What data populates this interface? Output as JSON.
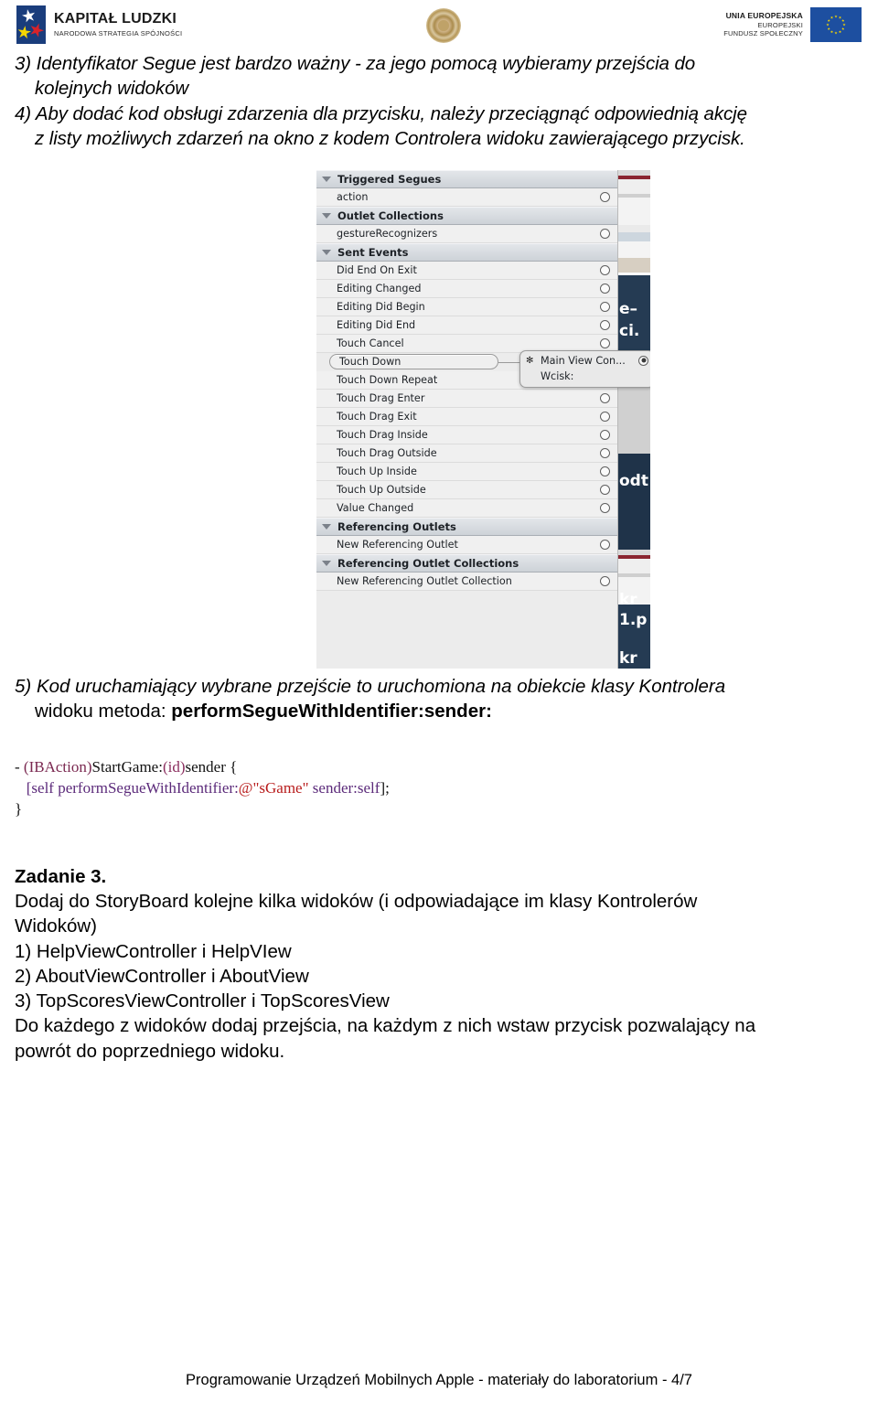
{
  "header": {
    "left_logo": {
      "title": "KAPITAŁ LUDZKI",
      "subtitle": "NARODOWA STRATEGIA SPÓJNOŚCI",
      "emblem": "kapital-ludzki-stars-emblem"
    },
    "center_logo": {
      "emblem": "university-gold-seal"
    },
    "right_logo": {
      "line1": "UNIA EUROPEJSKA",
      "line2": "EUROPEJSKI",
      "line3": "FUNDUSZ SPOŁECZNY",
      "emblem": "eu-flag-icon",
      "flag_color": "#1d4fa0",
      "star_color": "#f5d500"
    }
  },
  "body": {
    "item3": {
      "marker": "3)",
      "line1": "Identyfikator Segue jest bardzo ważny - za jego pomocą wybieramy przejścia do",
      "line2": "kolejnych widoków"
    },
    "item4": {
      "marker": "4)",
      "line1": "Aby dodać kod obsługi zdarzenia dla przycisku, należy przeciągnąć odpowiednią akcję",
      "line2": "z listy możliwych zdarzeń na okno z kodem Controlera widoku zawierającego przycisk."
    },
    "item5": {
      "marker": "5)",
      "line1": "Kod uruchamiający wybrane przejście to uruchomiona na obiekcie klasy Kontrolera",
      "line2_prefix": "widoku metoda: ",
      "line2_bold": "performSegueWithIdentifier:sender:"
    },
    "code": {
      "l1_dash": "- ",
      "l1_ibaction": "(IBAction)",
      "l1_name": "StartGame:",
      "l1_id": "(id)",
      "l1_sender": "sender {",
      "l2_open": "[self ",
      "l2_msg": "performSegueWithIdentifier:",
      "l2_str": "@\"sGame\"",
      "l2_sender": " sender:self",
      "l2_close": "];",
      "l3": "}"
    },
    "zadanie": {
      "title": "Zadanie 3.",
      "intro1": "Dodaj do StoryBoard kolejne kilka widoków (i odpowiadające im klasy Kontrolerów",
      "intro2": "Widoków)",
      "items": [
        "1) HelpViewController i HelpVIew",
        "2) AboutViewController i AboutView",
        "3) TopScoresViewController i TopScoresView"
      ],
      "outro1": "Do każdego z widoków dodaj przejścia, na każdym z nich wstaw przycisk pozwalający na",
      "outro2": "powrót do poprzedniego widoku."
    }
  },
  "screenshot": {
    "caption": "xcode-connections-inspector",
    "sections": [
      {
        "title": "Triggered Segues"
      },
      {
        "title": "Outlet Collections"
      },
      {
        "title": "Sent Events"
      },
      {
        "title": "Referencing Outlets"
      },
      {
        "title": "Referencing Outlet Collections"
      }
    ],
    "triggered_segues": [
      {
        "label": "action",
        "connected": false
      }
    ],
    "outlet_collections": [
      {
        "label": "gestureRecognizers",
        "connected": false
      }
    ],
    "sent_events": [
      {
        "label": "Did End On Exit",
        "connected": false
      },
      {
        "label": "Editing Changed",
        "connected": false
      },
      {
        "label": "Editing Did Begin",
        "connected": false
      },
      {
        "label": "Editing Did End",
        "connected": false
      },
      {
        "label": "Touch Cancel",
        "connected": false
      },
      {
        "label": "Touch Down",
        "connected": true,
        "selected": true
      },
      {
        "label": "Touch Down Repeat",
        "connected": false
      },
      {
        "label": "Touch Drag Enter",
        "connected": false
      },
      {
        "label": "Touch Drag Exit",
        "connected": false
      },
      {
        "label": "Touch Drag Inside",
        "connected": false
      },
      {
        "label": "Touch Drag Outside",
        "connected": false
      },
      {
        "label": "Touch Up Inside",
        "connected": false
      },
      {
        "label": "Touch Up Outside",
        "connected": false
      },
      {
        "label": "Value Changed",
        "connected": false
      }
    ],
    "referencing_outlets": [
      {
        "label": "New Referencing Outlet",
        "connected": false
      }
    ],
    "referencing_outlet_collections": [
      {
        "label": "New Referencing Outlet Collection",
        "connected": false
      }
    ],
    "popover": {
      "bullet": "✻",
      "target": "Main View Con...",
      "action": "Wcisk:"
    }
  },
  "footer": {
    "text": "Programowanie Urządzeń Mobilnych Apple  - materiały do laboratorium - 4/7"
  }
}
